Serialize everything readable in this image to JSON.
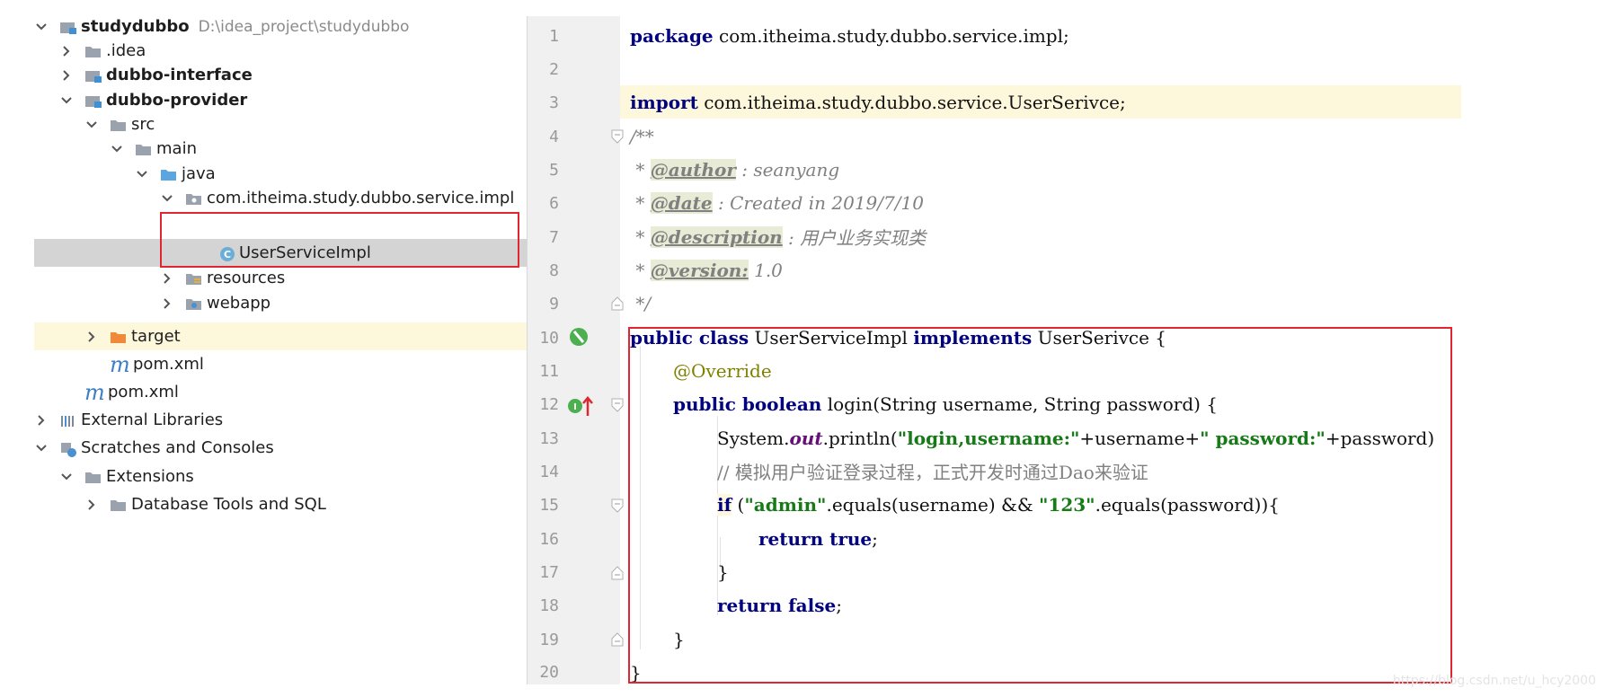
{
  "tree": {
    "root": {
      "name": "studydubbo",
      "path": "D:\\idea_project\\studydubbo"
    },
    "items": [
      {
        "label": ".idea"
      },
      {
        "label": "dubbo-interface"
      },
      {
        "label": "dubbo-provider"
      },
      {
        "label": "src"
      },
      {
        "label": "main"
      },
      {
        "label": "java"
      },
      {
        "label": "com.itheima.study.dubbo.service.impl"
      },
      {
        "label": "UserServiceImpl"
      },
      {
        "label": "resources"
      },
      {
        "label": "webapp"
      },
      {
        "label": "target"
      },
      {
        "label": "pom.xml"
      },
      {
        "label": "pom.xml"
      },
      {
        "label": "External Libraries"
      },
      {
        "label": "Scratches and Consoles"
      },
      {
        "label": "Extensions"
      },
      {
        "label": "Database Tools and SQL"
      }
    ]
  },
  "editor": {
    "line_numbers": [
      "1",
      "2",
      "3",
      "4",
      "5",
      "6",
      "7",
      "8",
      "9",
      "10",
      "11",
      "12",
      "13",
      "14",
      "15",
      "16",
      "17",
      "18",
      "19",
      "20"
    ],
    "code": {
      "l1_kw": "package",
      "l1_rest": " com.itheima.study.dubbo.service.impl;",
      "l3_kw": "import",
      "l3_rest": " com.itheima.study.dubbo.service.UserSerivce;",
      "l4": "/**",
      "l5_pre": " * ",
      "l5_tag": "@author",
      "l5_rest": " : seanyang",
      "l6_pre": " * ",
      "l6_tag": "@date",
      "l6_rest": " : Created in 2019/7/10",
      "l7_pre": " * ",
      "l7_tag": "@description",
      "l7_rest": " : 用户业务实现类",
      "l8_pre": " * ",
      "l8_tag": "@version:",
      "l8_rest": " 1.0",
      "l9": " */",
      "l10_kw1": "public class",
      "l10_a": " UserServiceImpl ",
      "l10_kw2": "implements",
      "l10_b": " UserSerivce {",
      "l11": "@Override",
      "l12_kw": "public boolean",
      "l12_rest": " login(String username, String password) {",
      "l13_a": "System.",
      "l13_fld": "out",
      "l13_b": ".println(",
      "l13_s1": "\"login,username:\"",
      "l13_c": "+username+",
      "l13_s2": "\" password:\"",
      "l13_d": "+password)",
      "l14": "// 模拟用户验证登录过程，正式开发时通过Dao来验证",
      "l15_kw": "if",
      "l15_a": " (",
      "l15_s1": "\"admin\"",
      "l15_b": ".equals(username) && ",
      "l15_s2": "\"123\"",
      "l15_c": ".equals(password)){",
      "l16_kw": "return true",
      "l16_rest": ";",
      "l17": "}",
      "l18_kw": "return false",
      "l18_rest": ";",
      "l19": "}",
      "l20": "}"
    }
  },
  "watermark": "https://blog.csdn.net/u_hcy2000",
  "colors": {
    "highlight_box": "#e0262e",
    "keyword": "#000080",
    "string": "#167a16",
    "current_line": "#fdf7dc"
  }
}
